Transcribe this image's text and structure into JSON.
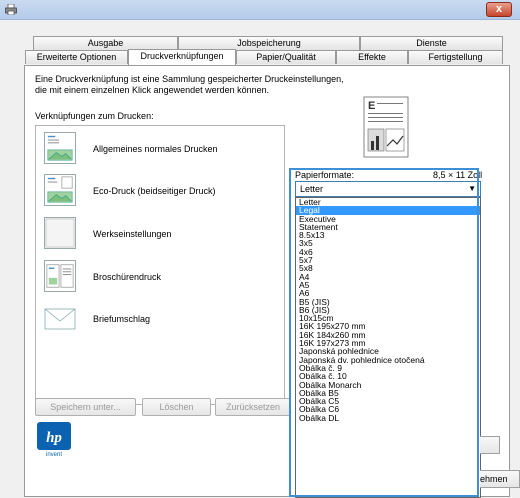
{
  "window": {
    "close_label": "x"
  },
  "tabs_row1": [
    "Ausgabe",
    "Jobspeicherung",
    "Dienste"
  ],
  "tabs_row2": [
    "Erweiterte Optionen",
    "Druckverknüpfungen",
    "Papier/Qualität",
    "Effekte",
    "Fertigstellung"
  ],
  "active_tab": "Druckverknüpfungen",
  "description": {
    "line1": "Eine Druckverknüpfung ist eine Sammlung gespeicherter Druckeinstellungen,",
    "line2": "die mit einem einzelnen Klick angewendet werden können."
  },
  "shortcuts": {
    "label": "Verknüpfungen zum Drucken:",
    "items": [
      {
        "label": "Allgemeines normales Drucken",
        "icon": "page-landscape-icon"
      },
      {
        "label": "Eco-Druck (beidseitiger Druck)",
        "icon": "duplex-page-icon"
      },
      {
        "label": "Werkseinstellungen",
        "icon": "blank-page-icon"
      },
      {
        "label": "Broschürendruck",
        "icon": "booklet-icon"
      },
      {
        "label": "Briefumschlag",
        "icon": "envelope-icon"
      }
    ]
  },
  "buttons": {
    "save": "Speichern unter...",
    "delete": "Löschen",
    "reset": "Zurücksetzen",
    "accept_partial": "ehmen"
  },
  "paper": {
    "label": "Papierformate:",
    "size": "8,5 × 11 Zoll",
    "selected": "Letter",
    "highlighted": "Legal",
    "options": [
      "Letter",
      "Legal",
      "Executive",
      "Statement",
      "8.5x13",
      "3x5",
      "4x6",
      "5x7",
      "5x8",
      "A4",
      "A5",
      "A6",
      "B5 (JIS)",
      "B6 (JIS)",
      "10x15cm",
      "16K 195x270 mm",
      "16K 184x260 mm",
      "16K 197x273 mm",
      "Japonská pohlednice",
      "Japonská dv. pohlednice otočená",
      "Obálka č. 9",
      "Obálka č. 10",
      "Obálka Monarch",
      "Obálka B5",
      "Obálka C5",
      "Obálka C6",
      "Obálka DL"
    ]
  },
  "logo": {
    "brand": "hp",
    "tagline": "invent"
  },
  "colors": {
    "selection": "#3399ff",
    "frame": "#3e8fd6",
    "close": "#c8452c"
  }
}
